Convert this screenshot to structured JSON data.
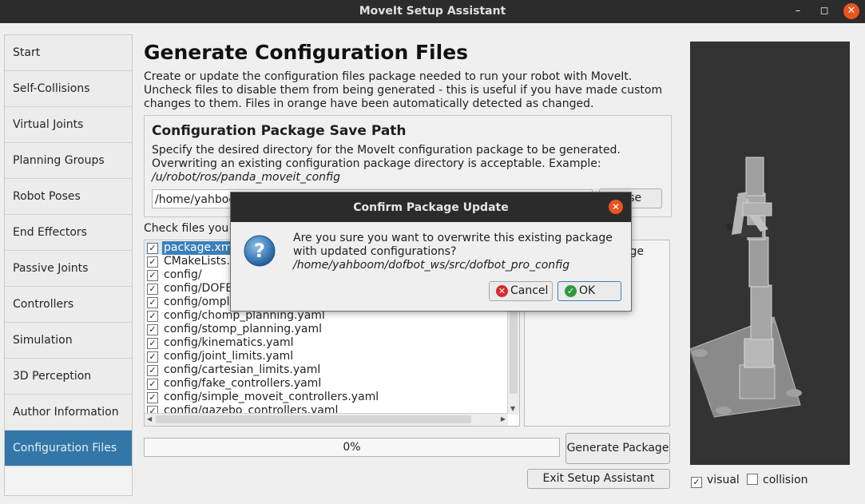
{
  "window": {
    "title": "MoveIt Setup Assistant"
  },
  "sidebar": {
    "items": [
      {
        "label": "Start"
      },
      {
        "label": "Self-Collisions"
      },
      {
        "label": "Virtual Joints"
      },
      {
        "label": "Planning Groups"
      },
      {
        "label": "Robot Poses"
      },
      {
        "label": "End Effectors"
      },
      {
        "label": "Passive Joints"
      },
      {
        "label": "Controllers"
      },
      {
        "label": "Simulation"
      },
      {
        "label": "3D Perception"
      },
      {
        "label": "Author Information"
      },
      {
        "label": "Configuration Files",
        "active": true
      }
    ]
  },
  "main": {
    "heading": "Generate Configuration Files",
    "intro": "Create or update the configuration files package needed to run your robot with MoveIt. Uncheck files to disable them from being generated - this is useful if you have made custom changes to them. Files in orange have been automatically detected as changed.",
    "save_path": {
      "heading": "Configuration Package Save Path",
      "description": "Specify the desired directory for the MoveIt configuration package to be generated. Overwriting an existing configuration package directory is acceptable. Example: ",
      "example": "/u/robot/ros/panda_moveit_config",
      "value": "/home/yahboo",
      "browse_label": "wse"
    },
    "check_label": "Check files you v",
    "files": [
      {
        "name": "package.xml",
        "checked": true,
        "selected": true
      },
      {
        "name": "CMakeLists.t",
        "checked": true
      },
      {
        "name": "config/",
        "checked": true
      },
      {
        "name": "config/DOFE",
        "checked": true
      },
      {
        "name": "config/ompl",
        "checked": true
      },
      {
        "name": "config/chomp_planning.yaml",
        "checked": true
      },
      {
        "name": "config/stomp_planning.yaml",
        "checked": true
      },
      {
        "name": "config/kinematics.yaml",
        "checked": true
      },
      {
        "name": "config/joint_limits.yaml",
        "checked": true
      },
      {
        "name": "config/cartesian_limits.yaml",
        "checked": true
      },
      {
        "name": "config/fake_controllers.yaml",
        "checked": true
      },
      {
        "name": "config/simple_moveit_controllers.yaml",
        "checked": true
      },
      {
        "name": "config/gazebo_controllers.yaml",
        "checked": true
      }
    ],
    "description_fragment": "kage",
    "progress": {
      "value": 0,
      "label": "0%"
    },
    "generate_label": "Generate Package",
    "exit_label": "Exit Setup Assistant"
  },
  "viewer": {
    "visual": {
      "label": "visual",
      "checked": true
    },
    "collision": {
      "label": "collision",
      "checked": false
    }
  },
  "dialog": {
    "title": "Confirm Package Update",
    "message": "Are you sure you want to overwrite this existing package with updated configurations?",
    "path": "/home/yahboom/dofbot_ws/src/dofbot_pro_config",
    "cancel_label": "Cancel",
    "ok_label": "OK",
    "icon": "question-icon"
  },
  "colors": {
    "accent": "#3277a8",
    "close": "#e95420",
    "titlebar": "#2c2c2c",
    "viewer_bg": "#333333"
  }
}
